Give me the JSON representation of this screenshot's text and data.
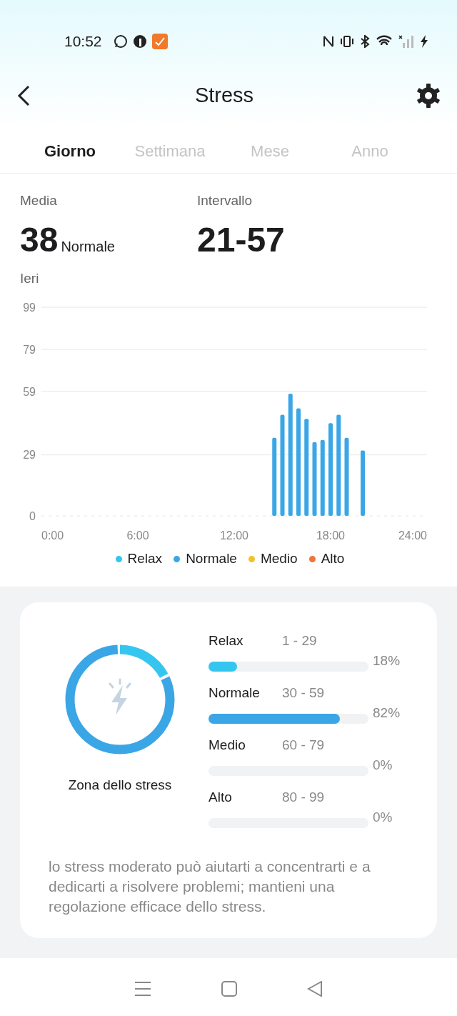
{
  "status_bar": {
    "time": "10:52"
  },
  "header": {
    "title": "Stress"
  },
  "tabs": [
    {
      "label": "Giorno",
      "selected": true
    },
    {
      "label": "Settimana",
      "selected": false
    },
    {
      "label": "Mese",
      "selected": false
    },
    {
      "label": "Anno",
      "selected": false
    }
  ],
  "summary": [
    {
      "label": "Media",
      "value": "38",
      "note": "Normale"
    },
    {
      "label": "Intervallo",
      "value": "21-57"
    }
  ],
  "day_label": "Ieri",
  "chart_data": {
    "type": "bar",
    "x": [
      14.5,
      15,
      15.5,
      16,
      16.5,
      17,
      17.5,
      18,
      18.5,
      19,
      20
    ],
    "values": [
      37,
      48,
      58,
      51,
      46,
      35,
      36,
      44,
      48,
      37,
      31
    ],
    "xlim": [
      0,
      24
    ],
    "ylim": [
      0,
      99
    ],
    "xticks": [
      {
        "value": 0,
        "label": "0:00"
      },
      {
        "value": 6,
        "label": "6:00"
      },
      {
        "value": 12,
        "label": "12:00"
      },
      {
        "value": 18,
        "label": "18:00"
      },
      {
        "value": 24,
        "label": "24:00"
      }
    ],
    "yticks": [
      0,
      29,
      59,
      79,
      99
    ],
    "grid": true
  },
  "legend": [
    {
      "label": "Relax",
      "color": "#35c6f0"
    },
    {
      "label": "Normale",
      "color": "#3aa6e6"
    },
    {
      "label": "Medio",
      "color": "#f3c12b"
    },
    {
      "label": "Alto",
      "color": "#f0733a"
    }
  ],
  "zone_title": "Zona dello stress",
  "zones": [
    {
      "name": "Relax",
      "range": "1 - 29",
      "level": 0.18,
      "percent": "18%"
    },
    {
      "name": "Normale",
      "range": "30 - 59",
      "level": 0.82,
      "percent": "82%"
    },
    {
      "name": "Medio",
      "range": "60 - 79",
      "percent": "0%"
    },
    {
      "name": "Alto",
      "range": "80 - 99",
      "percent": "0%"
    }
  ],
  "advice": "lo stress moderato può aiutarti a concentrarti e a dedicarti a risolvere problemi; mantieni una regolazione efficace dello stress."
}
